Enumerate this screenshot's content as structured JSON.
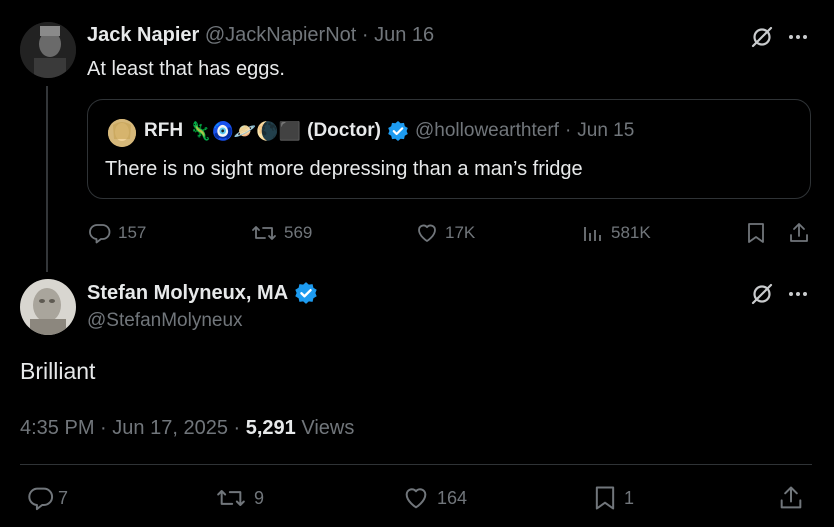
{
  "parent_tweet": {
    "author_name": "Jack Napier",
    "handle": "@JackNapierNot",
    "sep": "·",
    "date": "Jun 16",
    "text": "At least that has eggs.",
    "quote": {
      "author_name": "RFH",
      "emojis": "🦎🧿🪐🌘⬛",
      "suffix": "(Doctor)",
      "handle": "@hollowearthterf",
      "sep": "·",
      "date": "Jun 15",
      "text": "There is no sight more depressing than a man’s fridge"
    },
    "actions": {
      "replies": "157",
      "reposts": "569",
      "likes": "17K",
      "views": "581K"
    }
  },
  "main_tweet": {
    "author_name": "Stefan Molyneux, MA",
    "handle": "@StefanMolyneux",
    "text": "Brilliant",
    "time": "4:35 PM",
    "sep1": "·",
    "date": "Jun 17, 2025",
    "sep2": "·",
    "views_count": "5,291",
    "views_label": "Views",
    "actions": {
      "replies": "7",
      "reposts": "9",
      "likes": "164",
      "bookmarks": "1"
    }
  },
  "colors": {
    "background": "#000000",
    "text": "#e7e9ea",
    "secondary": "#71767b",
    "verified": "#1d9bf0",
    "border": "#2f3336"
  }
}
